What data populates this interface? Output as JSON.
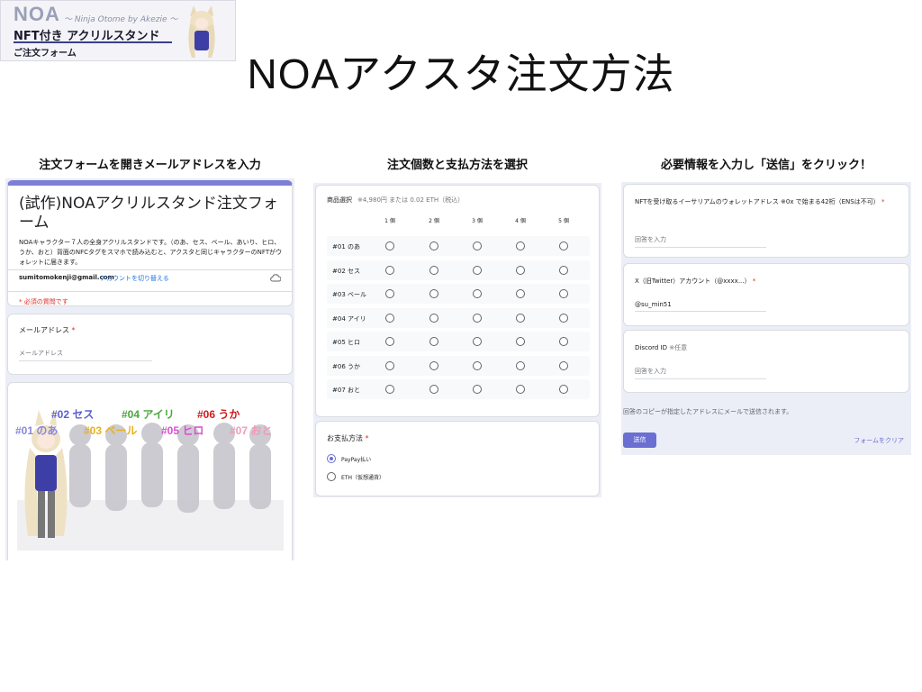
{
  "logo": {
    "brand": "NOA",
    "subtitle": "～ Ninja Otome by Akezie ～",
    "product": "NFT付き アクリルスタンド",
    "form_label": "ご注文フォーム"
  },
  "page_title": "NOAアクスタ注文方法",
  "steps": [
    {
      "caption": "注文フォームを開きメールアドレスを入力"
    },
    {
      "caption": "注文個数と支払方法を選択"
    },
    {
      "caption": "必要情報を入力し「送信」をクリック！"
    }
  ],
  "form_header": {
    "title": "(試作)NOAアクリルスタンド注文フォーム",
    "description": "NOAキャラクター７人の全身アクリルスタンドです。（のあ、セス、ベール、あいり、ヒロ、うか、おと）背面のNFCタグをスマホで読み込むと、アクスタと同じキャラクターのNFTがウォレットに届きます。",
    "account_email": "sumitomokenji@gmail.com",
    "switch_account": "アカウントを切り替える",
    "required_note": "* 必須の質問です"
  },
  "email_question": {
    "label": "メールアドレス",
    "required_mark": "*",
    "placeholder": "メールアドレス"
  },
  "character_labels": [
    {
      "text": "#02 セス",
      "color": "#5a5fd0"
    },
    {
      "text": "#04 アイリ",
      "color": "#4aa63a"
    },
    {
      "text": "#06 うか",
      "color": "#d11a1a"
    },
    {
      "text": "#01 のあ",
      "color": "#8b88e0"
    },
    {
      "text": "#03 ベール",
      "color": "#e8b020"
    },
    {
      "text": "#05 ヒロ",
      "color": "#d94fd0"
    },
    {
      "text": "#07 おと",
      "color": "#f29ab8"
    }
  ],
  "order_question": {
    "label": "商品選択",
    "price_note": "※4,980円 または 0.02 ETH（税込）",
    "columns": [
      "1 個",
      "2 個",
      "3 個",
      "4 個",
      "5 個"
    ],
    "rows": [
      "#01 のあ",
      "#02 セス",
      "#03 ベール",
      "#04 アイリ",
      "#05 ヒロ",
      "#06 うか",
      "#07 おと"
    ]
  },
  "payment_question": {
    "label": "お支払方法",
    "required_mark": "*",
    "options": [
      {
        "label": "PayPay払い",
        "selected": true
      },
      {
        "label": "ETH（仮想通貨）",
        "selected": false
      }
    ]
  },
  "wallet_question": {
    "label": "NFTを受け取るイーサリアムのウォレットアドレス ※0x で始まる42桁（ENSは不可）",
    "required_mark": "*",
    "placeholder": "回答を入力"
  },
  "twitter_question": {
    "label": "X（旧Twitter）アカウント（@xxxx...）",
    "required_mark": "*",
    "value": "@su_min51"
  },
  "discord_question": {
    "label": "Discord ID",
    "optional_note": "※任意",
    "placeholder": "回答を入力"
  },
  "footer": {
    "copy_note": "回答のコピーが指定したアドレスにメールで送信されます。",
    "submit_label": "送信",
    "clear_label": "フォームをクリア"
  },
  "colors": {
    "accent": "#6a6fd1",
    "panel_bg": "#eceef7",
    "required": "#d93025",
    "link": "#1a73e8"
  }
}
